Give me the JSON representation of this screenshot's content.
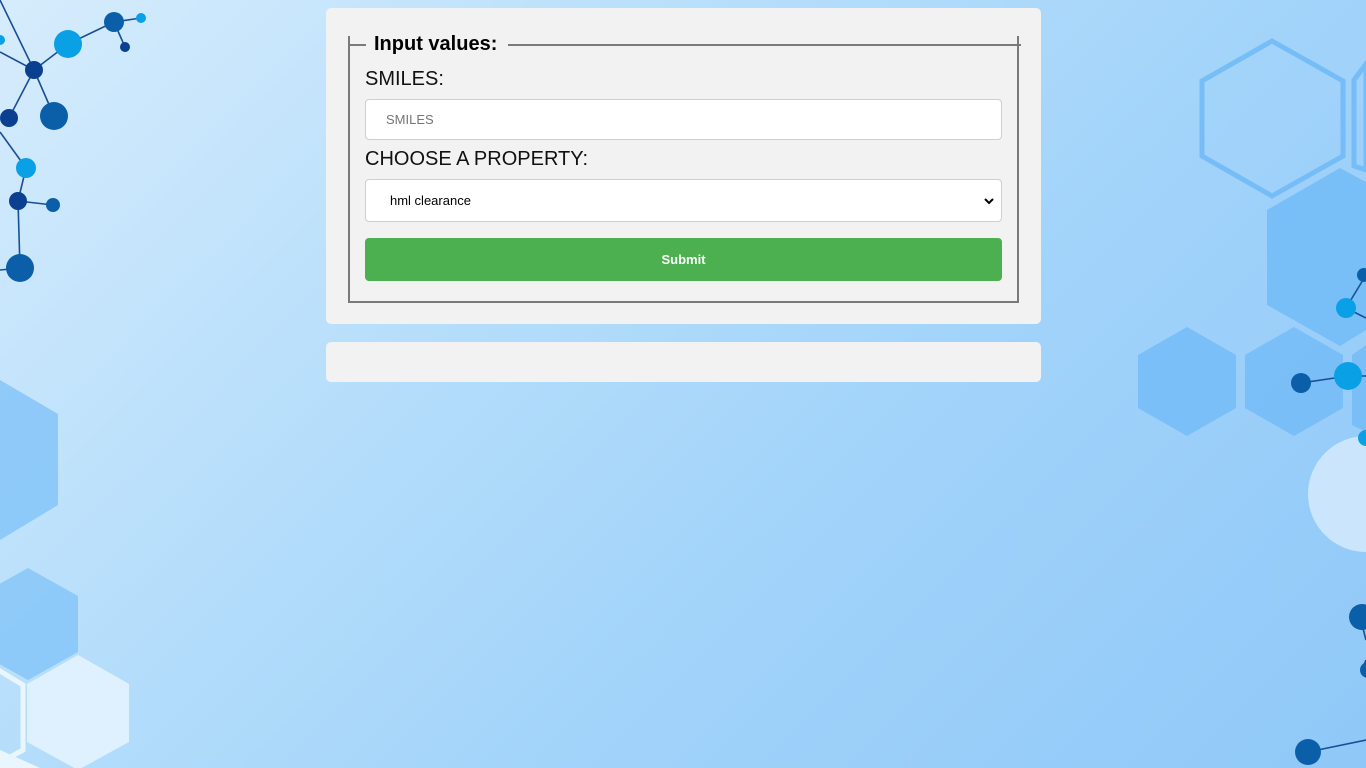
{
  "form": {
    "legend": "Input values:",
    "smiles_label": "SMILES:",
    "smiles_placeholder": "SMILES",
    "smiles_value": "",
    "property_label": "CHOOSE A PROPERTY:",
    "property_selected": "hml clearance",
    "submit_label": "Submit"
  },
  "result": {
    "text": ""
  },
  "colors": {
    "panel_bg": "#f2f2f2",
    "submit_bg": "#4caf50",
    "fieldset_border": "#7a7a7a",
    "hex_light": "#7cc0f8",
    "atom_dark": "#0a3d91",
    "atom_light": "#0aa0e6"
  },
  "icons": {
    "select_arrow": "chevron-down-icon"
  }
}
